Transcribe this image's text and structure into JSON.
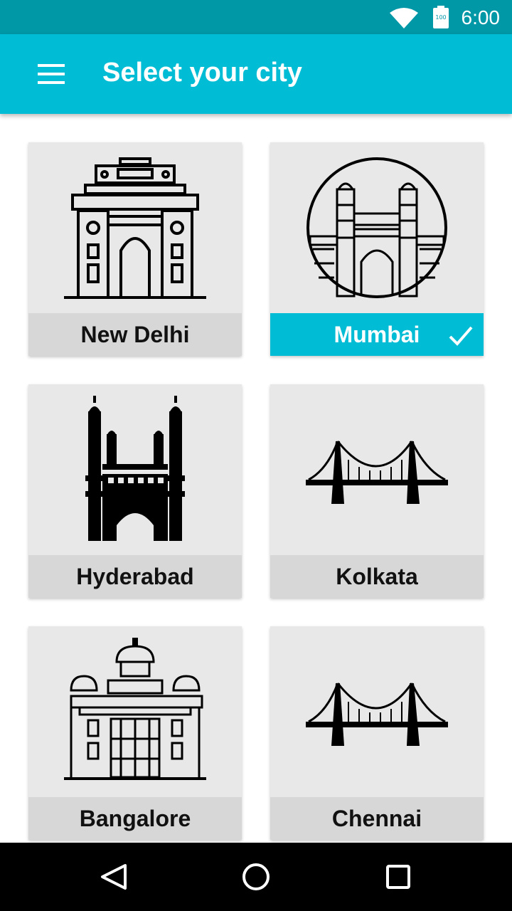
{
  "status": {
    "time": "6:00",
    "battery_text": "100"
  },
  "app_bar": {
    "title": "Select your city"
  },
  "cities": [
    {
      "name": "New Delhi",
      "selected": false
    },
    {
      "name": "Mumbai",
      "selected": true
    },
    {
      "name": "Hyderabad",
      "selected": false
    },
    {
      "name": "Kolkata",
      "selected": false
    },
    {
      "name": "Bangalore",
      "selected": false
    },
    {
      "name": "Chennai",
      "selected": false
    }
  ],
  "colors": {
    "primary": "#00bcd4",
    "primary_dark": "#0097a7",
    "card": "#e8e8e8",
    "label": "#d7d7d7"
  }
}
